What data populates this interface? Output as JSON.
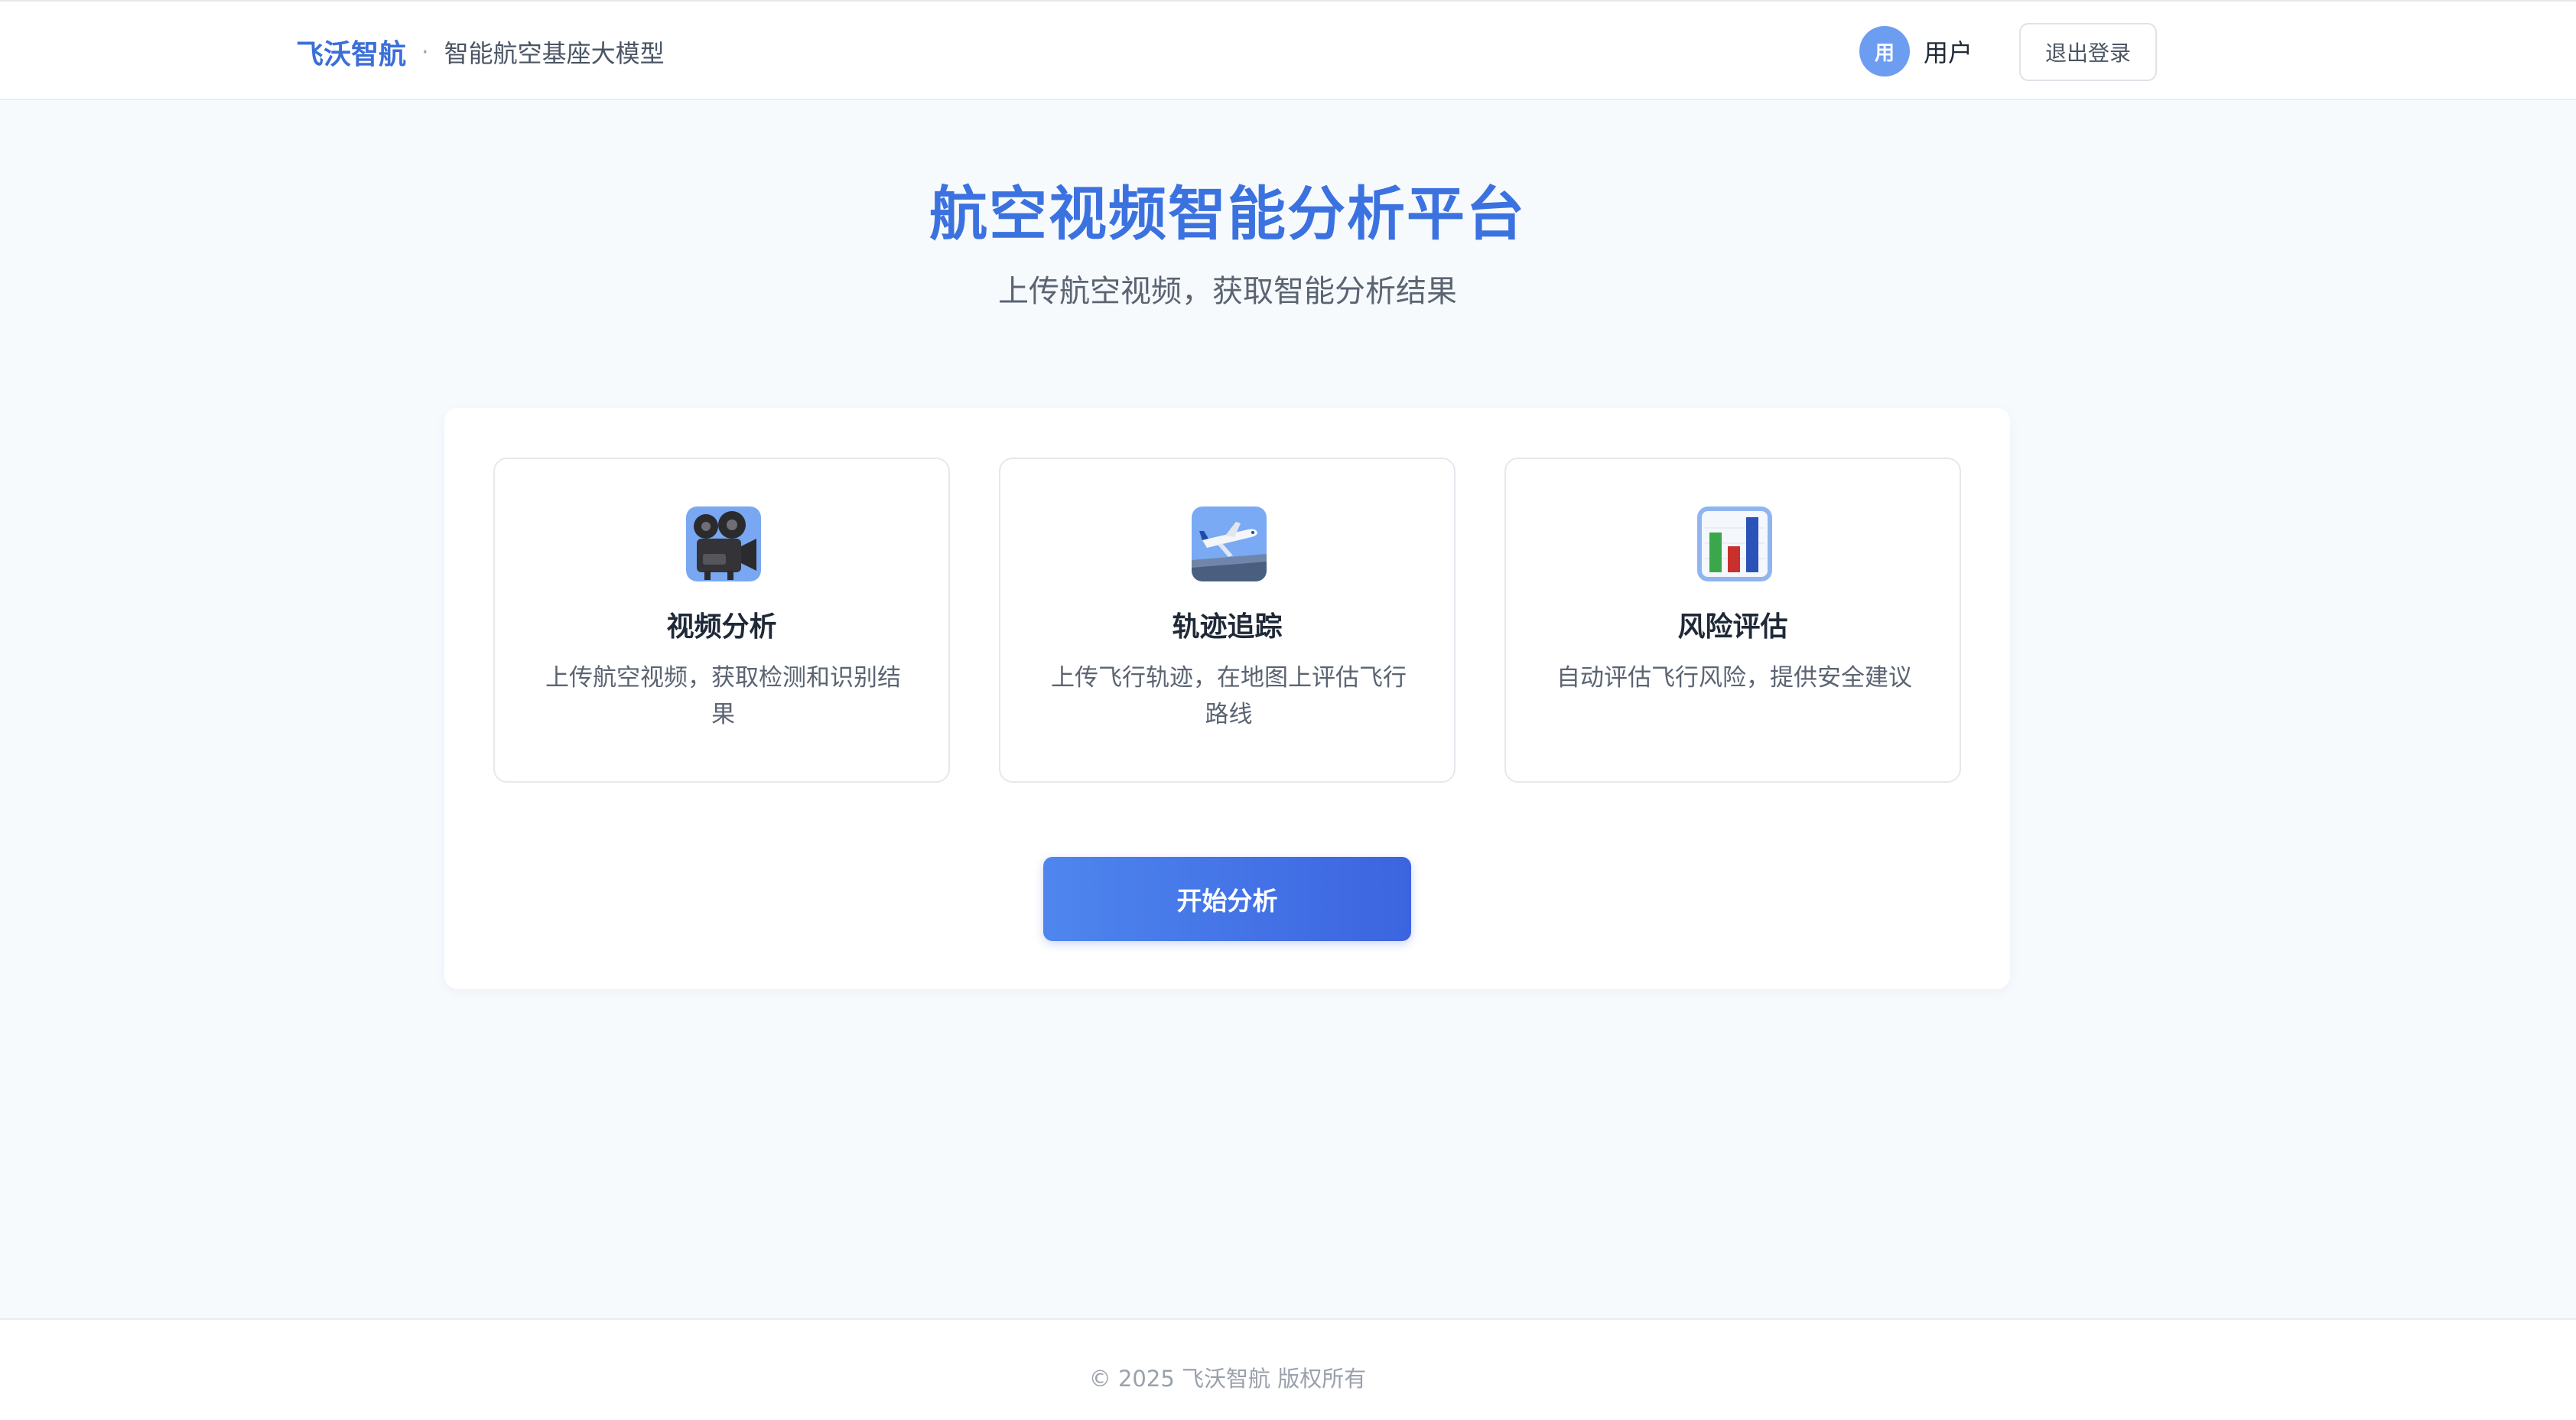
{
  "header": {
    "brand_name": "飞沃智航",
    "separator": "·",
    "brand_subtitle": "智能航空基座大模型",
    "user": {
      "avatar_text": "用",
      "name": "用户"
    },
    "logout_label": "退出登录"
  },
  "hero": {
    "title": "航空视频智能分析平台",
    "subtitle": "上传航空视频，获取智能分析结果"
  },
  "features": [
    {
      "icon": "movie-camera-icon",
      "title": "视频分析",
      "description": "上传航空视频，获取检测和识别结果"
    },
    {
      "icon": "airplane-icon",
      "title": "轨迹追踪",
      "description": "上传飞行轨迹，在地图上评估飞行路线"
    },
    {
      "icon": "bar-chart-icon",
      "title": "风险评估",
      "description": "自动评估飞行风险，提供安全建议"
    }
  ],
  "start_button_label": "开始分析",
  "footer": {
    "copyright": "© 2025 飞沃智航 版权所有"
  },
  "colors": {
    "brand": "#3b6fd8",
    "hero_title": "#3b72e0",
    "button_start": "#4e86ee",
    "button_end": "#3c64e0",
    "avatar": "#6d9df0",
    "background": "#f7fafd"
  }
}
